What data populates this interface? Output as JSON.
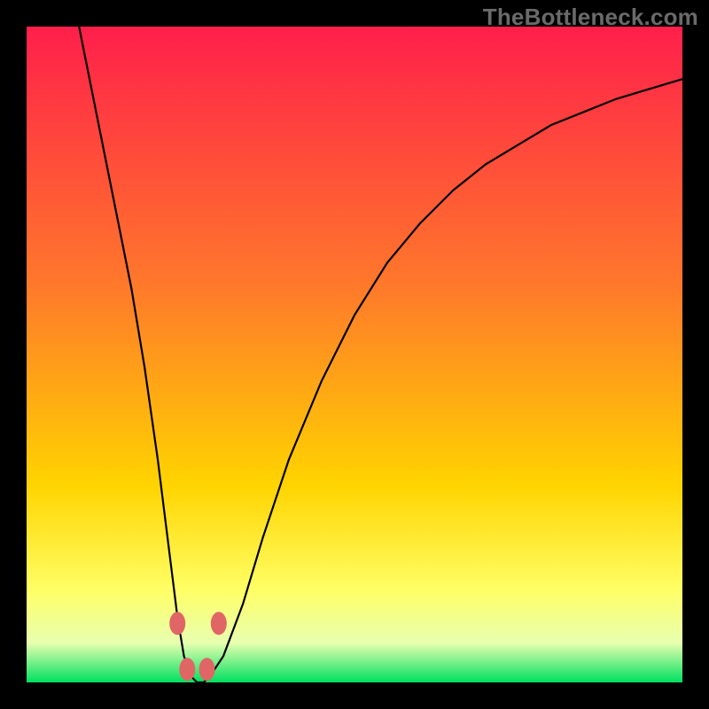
{
  "watermark": "TheBottleneck.com",
  "accent_colors": {
    "gradient_top": "#ff1f4b",
    "gradient_mid1": "#ff7a2a",
    "gradient_mid2": "#ffd400",
    "gradient_mid3": "#ffff66",
    "gradient_mid4": "#e8ffb0",
    "gradient_bottom": "#00e060",
    "curve": "#000000",
    "marker": "#e06666"
  },
  "chart_data": {
    "type": "line",
    "title": "",
    "xlabel": "",
    "ylabel": "",
    "xlim": [
      0,
      100
    ],
    "ylim": [
      0,
      100
    ],
    "series": [
      {
        "name": "bottleneck-curve",
        "x": [
          8,
          10,
          12,
          14,
          16,
          18,
          20,
          21,
          22,
          23,
          24,
          25,
          26,
          27,
          28,
          30,
          33,
          36,
          40,
          45,
          50,
          55,
          60,
          65,
          70,
          75,
          80,
          85,
          90,
          95,
          100
        ],
        "y": [
          100,
          90,
          80,
          70,
          60,
          48,
          34,
          26,
          18,
          10,
          4,
          1,
          0,
          0,
          1,
          4,
          12,
          22,
          34,
          46,
          56,
          64,
          70,
          75,
          79,
          82,
          85,
          87,
          89,
          90.5,
          92
        ]
      }
    ],
    "markers": [
      {
        "x": 23.0,
        "y": 9.0
      },
      {
        "x": 24.5,
        "y": 2.0
      },
      {
        "x": 27.5,
        "y": 2.0
      },
      {
        "x": 29.3,
        "y": 9.0
      }
    ],
    "bands": [
      {
        "y0": 0.0,
        "y1": 2.5,
        "label": "green"
      },
      {
        "y0": 2.5,
        "y1": 15.0,
        "label": "yellow"
      },
      {
        "y0": 15.0,
        "y1": 60.0,
        "label": "orange"
      },
      {
        "y0": 60.0,
        "y1": 100.0,
        "label": "red"
      }
    ]
  }
}
